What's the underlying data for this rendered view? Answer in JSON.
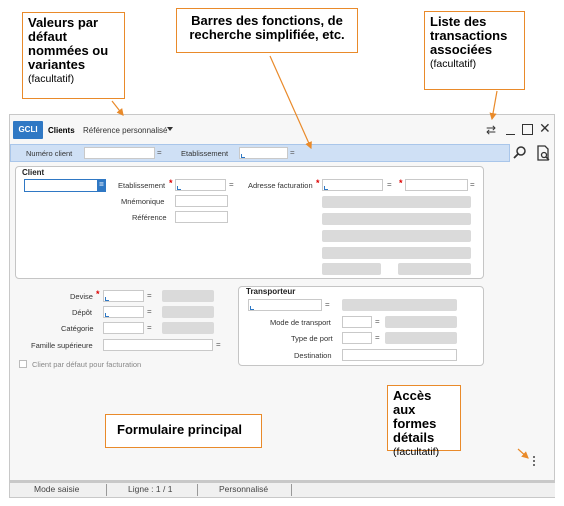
{
  "annotations": {
    "defaults": {
      "title": "Valeurs par défaut nommées ou variantes",
      "note": "(facultatif)"
    },
    "toolbar": {
      "title": "Barres des fonctions, de recherche simplifiée, etc."
    },
    "transactions": {
      "title": "Liste des transactions associées",
      "note": "(facultatif)"
    },
    "main_form": {
      "title": "Formulaire principal"
    },
    "details": {
      "title": "Accès aux formes détails",
      "note": "(facultatif)"
    }
  },
  "titlebar": {
    "app_code": "GCLI",
    "screen_title": "Clients",
    "reference": "Référence personnalisé",
    "transactions_icon": "swap-icon",
    "minimize_icon": "minimize-icon",
    "maximize_icon": "maximize-icon",
    "close_icon": "close-icon"
  },
  "searchbar": {
    "numero_client_label": "Numéro client",
    "numero_client_value": "",
    "etablissement_label": "Etablissement",
    "etablissement_value": "",
    "eq": "="
  },
  "client_panel": {
    "title": "Client",
    "client_value": "",
    "etablissement_label": "Etablissement",
    "mnemonique_label": "Mnémonique",
    "reference_label": "Référence",
    "adresse_facturation_label": "Adresse facturation",
    "required_mark": "*",
    "eq": "="
  },
  "left_fields": {
    "devise_label": "Devise",
    "depot_label": "Dépôt",
    "categorie_label": "Catégorie",
    "famille_label": "Famille supérieure",
    "checkbox_label": "Client par défaut pour facturation",
    "checkbox_checked": false
  },
  "transporteur_panel": {
    "title": "Transporteur",
    "mode_transport_label": "Mode de transport",
    "type_port_label": "Type de port",
    "destination_label": "Destination"
  },
  "statusbar": {
    "mode": "Mode saisie",
    "ligne": "Ligne : 1 / 1",
    "personnalise": "Personnalisé"
  },
  "colors": {
    "accent": "#2f78c4",
    "annotation_border": "#e98a2a",
    "searchbar_bg": "#cfe0f5"
  }
}
